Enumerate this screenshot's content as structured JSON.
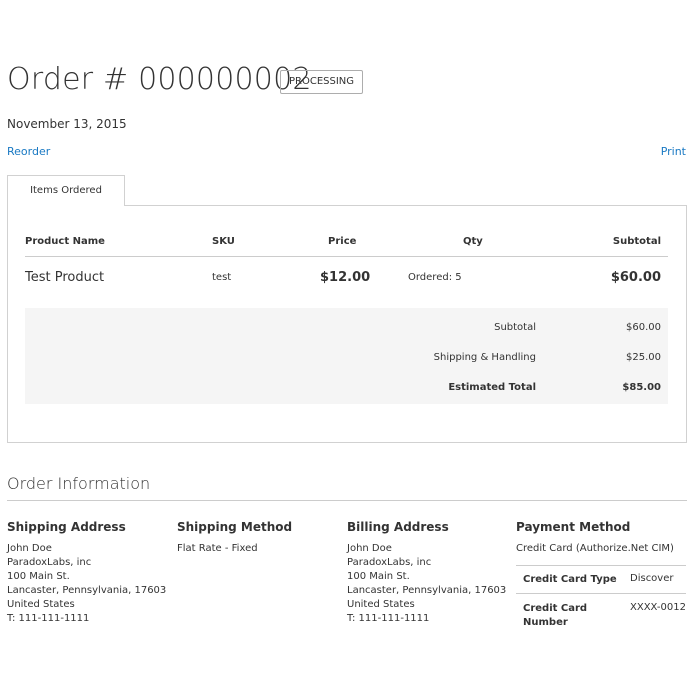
{
  "order": {
    "title": "Order # 000000002",
    "status": "PROCESSING",
    "date": "November 13, 2015"
  },
  "actions": {
    "reorder": "Reorder",
    "print": "Print"
  },
  "tabs": [
    {
      "label": "Items Ordered",
      "active": true
    }
  ],
  "items_table": {
    "headers": [
      "Product Name",
      "SKU",
      "Price",
      "Qty",
      "Subtotal"
    ],
    "rows": [
      {
        "name": "Test Product",
        "sku": "test",
        "price": "$12.00",
        "qty": "Ordered: 5",
        "subtotal": "$60.00"
      }
    ],
    "totals": [
      {
        "label": "Subtotal",
        "value": "$60.00"
      },
      {
        "label": "Shipping & Handling",
        "value": "$25.00"
      },
      {
        "label": "Estimated Total",
        "value": "$85.00"
      }
    ]
  },
  "order_info": {
    "title": "Order Information",
    "shipping_address": {
      "title": "Shipping Address",
      "lines": [
        "John Doe",
        "ParadoxLabs, inc",
        "100 Main St.",
        "Lancaster, Pennsylvania, 17603",
        "United States",
        "T: 111-111-1111"
      ]
    },
    "shipping_method": {
      "title": "Shipping Method",
      "value": "Flat Rate - Fixed"
    },
    "billing_address": {
      "title": "Billing Address",
      "lines": [
        "John Doe",
        "ParadoxLabs, inc",
        "100 Main St.",
        "Lancaster, Pennsylvania, 17603",
        "United States",
        "T: 111-111-1111"
      ]
    },
    "payment_method": {
      "title": "Payment Method",
      "value": "Credit Card (Authorize.Net CIM)",
      "details": [
        {
          "label": "Credit Card Type",
          "value": "Discover"
        },
        {
          "label": "Credit Card Number",
          "value": "XXXX-0012"
        }
      ]
    }
  },
  "colors": {
    "link": "#1979c3",
    "text": "#333333",
    "border": "#d1d1d1",
    "totals_bg": "#f5f5f5"
  }
}
